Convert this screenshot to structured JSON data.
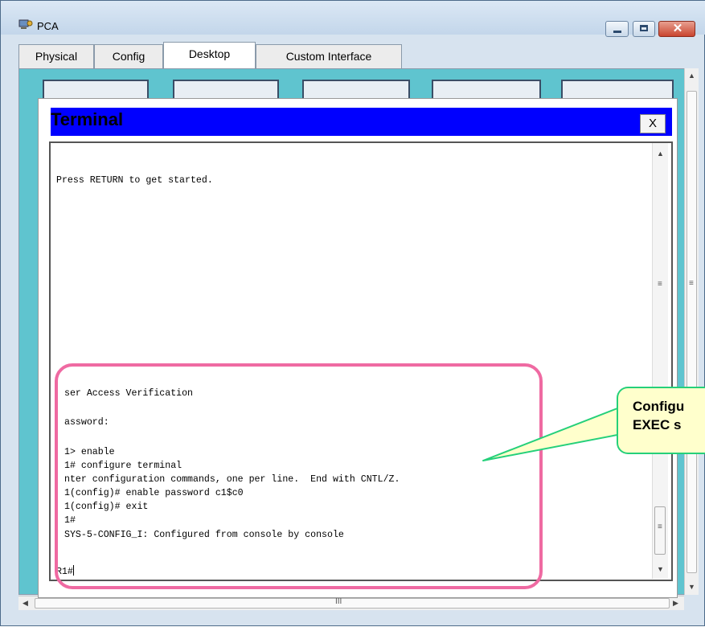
{
  "window": {
    "title": "PCA",
    "minimize_icon": "minimize-icon",
    "maximize_icon": "maximize-icon",
    "close_icon": "close-icon",
    "close_glyph": "✕"
  },
  "tabs": [
    {
      "label": "Physical"
    },
    {
      "label": "Config"
    },
    {
      "label": "Desktop",
      "active": true
    },
    {
      "label": "Custom Interface"
    }
  ],
  "terminal": {
    "title": "Terminal",
    "close_label": "X",
    "lines": [
      "Press RETURN to get started.",
      "ser Access Verification",
      "assword:",
      "1> enable",
      "1# configure terminal",
      "nter configuration commands, one per line.  End with CNTL/Z.",
      "1(config)# enable password c1$c0",
      "1(config)# exit",
      "1#",
      "SYS-5-CONFIG_I: Configured from console by console",
      "R1#"
    ]
  },
  "callout": {
    "text_line1": "Configu",
    "text_line2": "EXEC s"
  },
  "colors": {
    "terminal_header": "#0000ff",
    "highlight_border": "#ef6aa2",
    "callout_border": "#25d07a",
    "callout_fill": "#ffffcc",
    "desktop_bg": "#5fc4cf"
  }
}
